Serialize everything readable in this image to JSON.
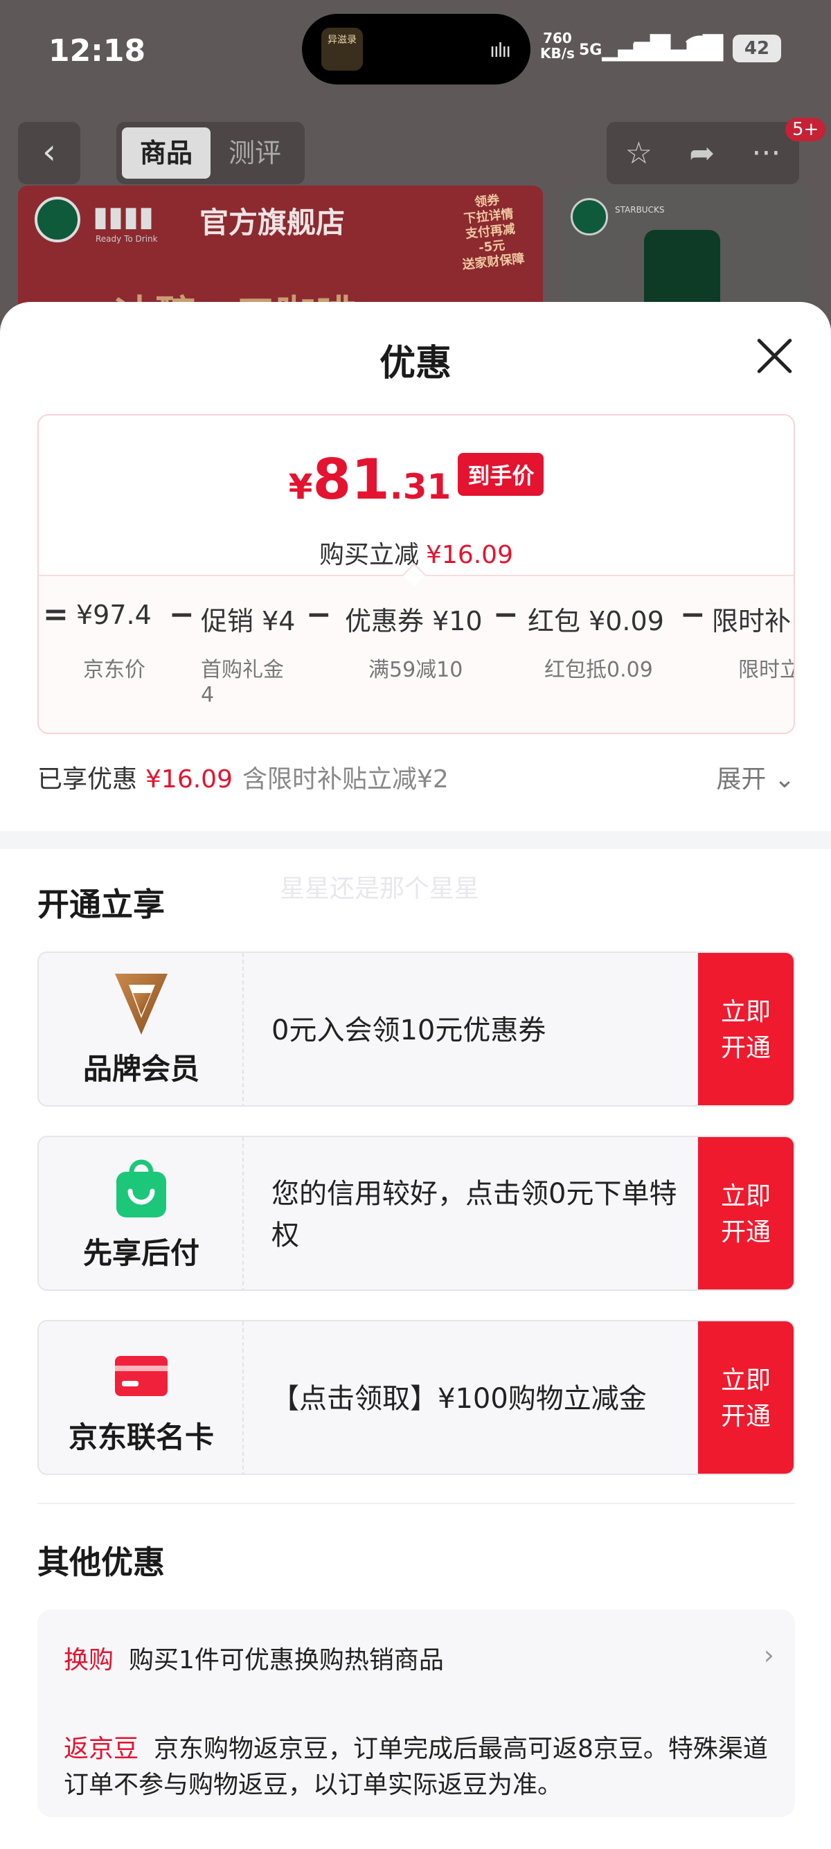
{
  "status_bar": {
    "time": "12:18",
    "island_thumb_text": "异滋录",
    "net_speed_value": "760",
    "net_speed_unit": "KB/s",
    "sim1": "5G",
    "sim2": "5G",
    "battery": "42"
  },
  "background_page": {
    "tabs": [
      "商品",
      "测评"
    ],
    "active_tab": "商品",
    "badge": "5+",
    "store_title": "官方旗舰店",
    "ready_to_drink": "Ready To Drink",
    "promo_sticker": "领券\n下拉详情\n支付再减\n-5元\n送家财保障",
    "banner_text": "冰醇一口咖啡",
    "side_brand": "STARBUCKS"
  },
  "sheet": {
    "title": "优惠",
    "price": {
      "symbol": "¥",
      "integer": "81",
      "decimal": ".31",
      "tag": "到手价",
      "saving_label": "购买立减",
      "saving_value": "¥16.09"
    },
    "breakdown": [
      {
        "op": "=",
        "main": "¥97.4",
        "sub": "京东价",
        "sub2": ""
      },
      {
        "op": "−",
        "main": "促销 ¥4",
        "sub": "首购礼金",
        "sub2": "4"
      },
      {
        "op": "−",
        "main": "优惠券 ¥10",
        "sub": "满59减10",
        "sub2": ""
      },
      {
        "op": "−",
        "main": "红包 ¥0.09",
        "sub": "红包抵0.09",
        "sub2": ""
      },
      {
        "op": "−",
        "main": "限时补",
        "sub": "限时立",
        "sub2": ""
      }
    ],
    "enjoyed": {
      "label": "已享优惠",
      "value": "¥16.09",
      "note": "含限时补贴立减¥2",
      "expand": "展开"
    },
    "open_section": {
      "title": "开通立享",
      "watermark": "星星还是那个星星",
      "items": [
        {
          "label": "品牌会员",
          "text": "0元入会领10元优惠券",
          "button": "立即开通",
          "icon": "brand-member-icon"
        },
        {
          "label": "先享后付",
          "text": "您的信用较好，点击领0元下单特权",
          "button": "立即开通",
          "icon": "shopping-bag-icon"
        },
        {
          "label": "京东联名卡",
          "text": "【点击领取】¥100购物立减金",
          "button": "立即开通",
          "icon": "card-icon"
        }
      ]
    },
    "other_section": {
      "title": "其他优惠",
      "items": [
        {
          "tag": "换购",
          "text": "购买1件可优惠换购热销商品"
        },
        {
          "tag": "返京豆",
          "text": "京东购物返京豆，订单完成后最高可返8京豆。特殊渠道订单不参与购物返豆，以订单实际返豆为准。"
        }
      ]
    }
  },
  "colors": {
    "accent_red": "#e4132f",
    "button_red": "#f01a2e",
    "dim_overlay": "#5f5858"
  }
}
